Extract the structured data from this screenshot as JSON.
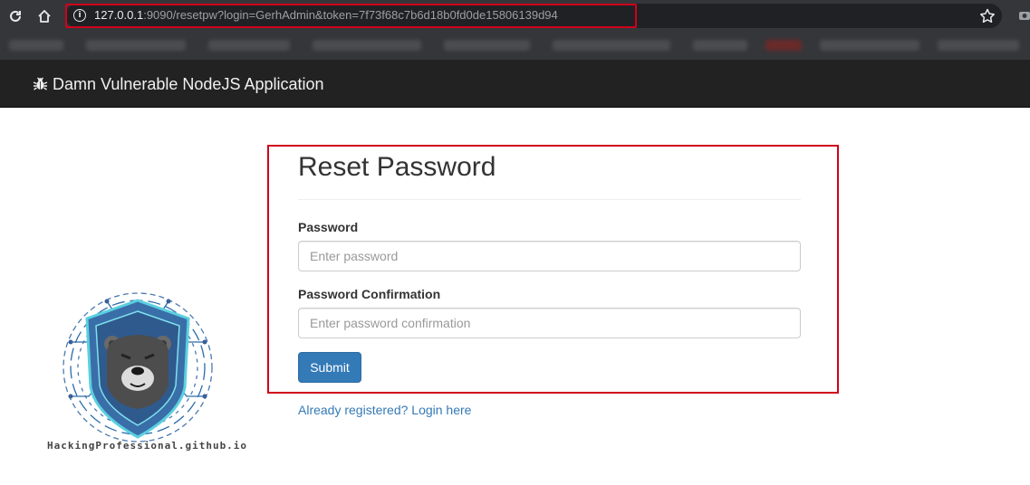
{
  "browser": {
    "url_host": "127.0.0.1",
    "url_rest": ":9090/resetpw?login=GerhAdmin&token=7f73f68c7b6d18b0fd0de15806139d94"
  },
  "navbar": {
    "brand": "Damn Vulnerable NodeJS Application"
  },
  "form": {
    "title": "Reset Password",
    "password_label": "Password",
    "password_placeholder": "Enter password",
    "confirm_label": "Password Confirmation",
    "confirm_placeholder": "Enter password confirmation",
    "submit_label": "Submit"
  },
  "links": {
    "login": "Already registered? Login here"
  },
  "logo": {
    "caption": "HackingProfessional.github.io"
  },
  "colors": {
    "highlight": "#d0021b",
    "primary": "#337ab7",
    "navbar": "#222222"
  }
}
